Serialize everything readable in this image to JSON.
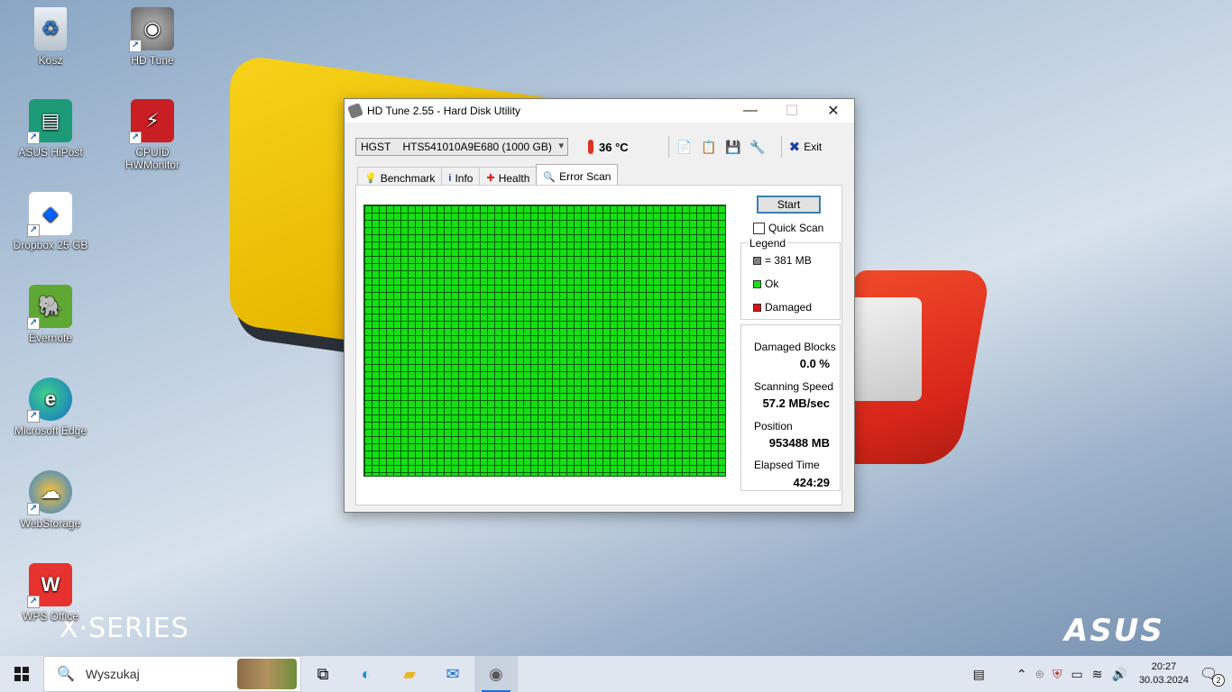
{
  "desktop": {
    "icons": [
      {
        "label": "Kosz",
        "icon": "recycle-bin-icon"
      },
      {
        "label": "HD Tune",
        "icon": "hd-tune-icon"
      },
      {
        "label": "ASUS HiPost",
        "icon": "asus-hipost-icon"
      },
      {
        "label": "CPUID HWMonitor",
        "icon": "cpuid-hwmonitor-icon"
      },
      {
        "label": "Dropbox 25 GB",
        "icon": "dropbox-icon"
      },
      {
        "label": "Evernote",
        "icon": "evernote-icon"
      },
      {
        "label": "Microsoft Edge",
        "icon": "edge-icon"
      },
      {
        "label": "WebStorage",
        "icon": "webstorage-icon"
      },
      {
        "label": "WPS Office",
        "icon": "wps-office-icon"
      }
    ],
    "wallpaper": {
      "series_text": "X·SERIES",
      "brand_text": "ASUS"
    }
  },
  "window": {
    "title": "HD Tune 2.55 - Hard Disk Utility",
    "controls": {
      "minimize": "—",
      "maximize": "☐",
      "close": "✕"
    },
    "drive_select": "HGST    HTS541010A9E680 (1000 GB)",
    "temperature": "36 °C",
    "toolbar": {
      "exit_label": "Exit"
    },
    "tabs": [
      {
        "label": "Benchmark",
        "active": false
      },
      {
        "label": "Info",
        "active": false
      },
      {
        "label": "Health",
        "active": false
      },
      {
        "label": "Error Scan",
        "active": true
      }
    ],
    "error_scan": {
      "start_label": "Start",
      "quick_scan_label": "Quick Scan",
      "quick_scan_checked": false,
      "legend_title": "Legend",
      "legend": [
        {
          "label": "= 381 MB",
          "color": "#808080"
        },
        {
          "label": "Ok",
          "color": "#14e014"
        },
        {
          "label": "Damaged",
          "color": "#e01010"
        }
      ],
      "stats": {
        "damaged_blocks_label": "Damaged Blocks",
        "damaged_blocks_value": "0.0 %",
        "scanning_speed_label": "Scanning Speed",
        "scanning_speed_value": "57.2 MB/sec",
        "position_label": "Position",
        "position_value": "953488 MB",
        "elapsed_time_label": "Elapsed Time",
        "elapsed_time_value": "424:29"
      },
      "grid_status": "ok",
      "ok_color": "#14e014"
    }
  },
  "taskbar": {
    "search_placeholder": "Wyszukaj",
    "apps": [
      "task-view-icon",
      "edge-icon",
      "file-explorer-icon",
      "mail-icon",
      "hd-tune-icon"
    ],
    "clock_time": "20:27",
    "clock_date": "30.03.2024",
    "notification_count": "2"
  }
}
